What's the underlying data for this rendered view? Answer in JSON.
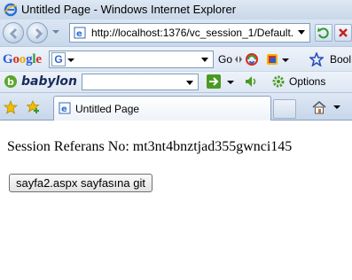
{
  "window": {
    "title": "Untitled Page - Windows Internet Explorer"
  },
  "address_bar": {
    "url": "http://localhost:1376/vc_session_1/Default."
  },
  "google_toolbar": {
    "logo": "Google",
    "search_value": "",
    "go_label": "Go",
    "bookmarks_label": "Bool"
  },
  "babylon_toolbar": {
    "logo": "babylon",
    "search_value": "",
    "options_label": "Options"
  },
  "tabs": [
    {
      "label": "Untitled Page"
    }
  ],
  "page": {
    "session_text": "Session Referans No: mt3nt4bnztjad355gwnci145",
    "button_label": "sayfa2.aspx sayfasına git"
  }
}
